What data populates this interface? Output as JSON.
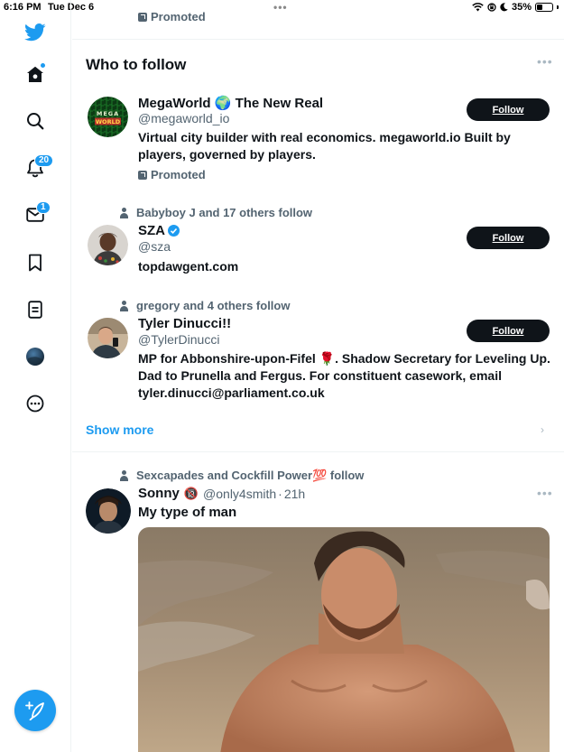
{
  "status_bar": {
    "time": "6:16 PM",
    "date": "Tue Dec 6",
    "battery": "35%",
    "battery_level": 0.35
  },
  "sidebar": {
    "items": [
      {
        "name": "twitter-logo",
        "icon": "bird-icon"
      },
      {
        "name": "home",
        "icon": "home-icon",
        "has_dot": true
      },
      {
        "name": "explore",
        "icon": "search-icon"
      },
      {
        "name": "notifications",
        "icon": "bell-icon",
        "badge": "20"
      },
      {
        "name": "messages",
        "icon": "envelope-icon",
        "badge": "1"
      },
      {
        "name": "bookmarks",
        "icon": "bookmark-icon"
      },
      {
        "name": "lists",
        "icon": "list-icon"
      },
      {
        "name": "profile",
        "icon": "avatar-icon"
      },
      {
        "name": "more",
        "icon": "more-circle-icon"
      }
    ],
    "compose_icon": "feather-plus-icon"
  },
  "top_promoted": "Promoted",
  "who_to_follow": {
    "title": "Who to follow",
    "follow_label": "Follow",
    "users": [
      {
        "name": "MegaWorld 🌍 The New Real",
        "handle": "@megaworld_io",
        "bio": "Virtual city builder with real economics. megaworld.io Built by players, governed by players.",
        "promoted": "Promoted",
        "avatar_text": "MEGA WORLD"
      },
      {
        "social": "Babyboy J and 17 others follow",
        "name": "SZA",
        "verified": true,
        "handle": "@sza",
        "bio": "topdawgent.com"
      },
      {
        "social": "gregory and 4 others follow",
        "name": "Tyler Dinucci!!",
        "handle": "@TylerDinucci",
        "bio": "MP for Abbonshire-upon-Fifel 🌹. Shadow Secretary for Leveling Up. Dad to Prunella and Fergus. For constituent casework, email tyler.dinucci@parliament.co.uk"
      }
    ],
    "show_more": "Show more"
  },
  "tweet": {
    "social": "Sexcapades and Cockfill Power💯 follow",
    "name": "Sonny",
    "badge_emoji": "🔞",
    "handle": "@only4smith",
    "separator": "·",
    "time": "21h",
    "text": "My type of man"
  },
  "colors": {
    "accent": "#1d9bf0",
    "text": "#0f1419",
    "secondary": "#536471",
    "border": "#eff3f4"
  }
}
